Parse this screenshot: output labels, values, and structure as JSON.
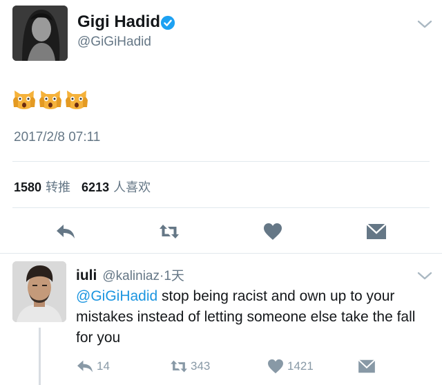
{
  "tweet": {
    "display_name": "Gigi Hadid",
    "handle": "@GiGiHadid",
    "emoji": [
      "scream-cat",
      "scream-cat",
      "scream-cat"
    ],
    "timestamp": "2017/2/8 07:11",
    "retweets_count": "1580",
    "retweets_label": "转推",
    "likes_count": "6213",
    "likes_label": "人喜欢"
  },
  "reply": {
    "display_name": "iuli",
    "handle": "@kaliniaz",
    "time": "·1天",
    "mention": "@GiGiHadid",
    "text": " stop being racist and own up to your mistakes instead of letting someone else take the fall for you",
    "reply_count": "14",
    "retweet_count": "343",
    "like_count": "1421"
  },
  "colors": {
    "text": "#14171a",
    "secondary": "#657786",
    "link": "#1b95e0",
    "action_main": "#657786",
    "action_reply": "#8899a6",
    "verified": "#1da1f2"
  }
}
